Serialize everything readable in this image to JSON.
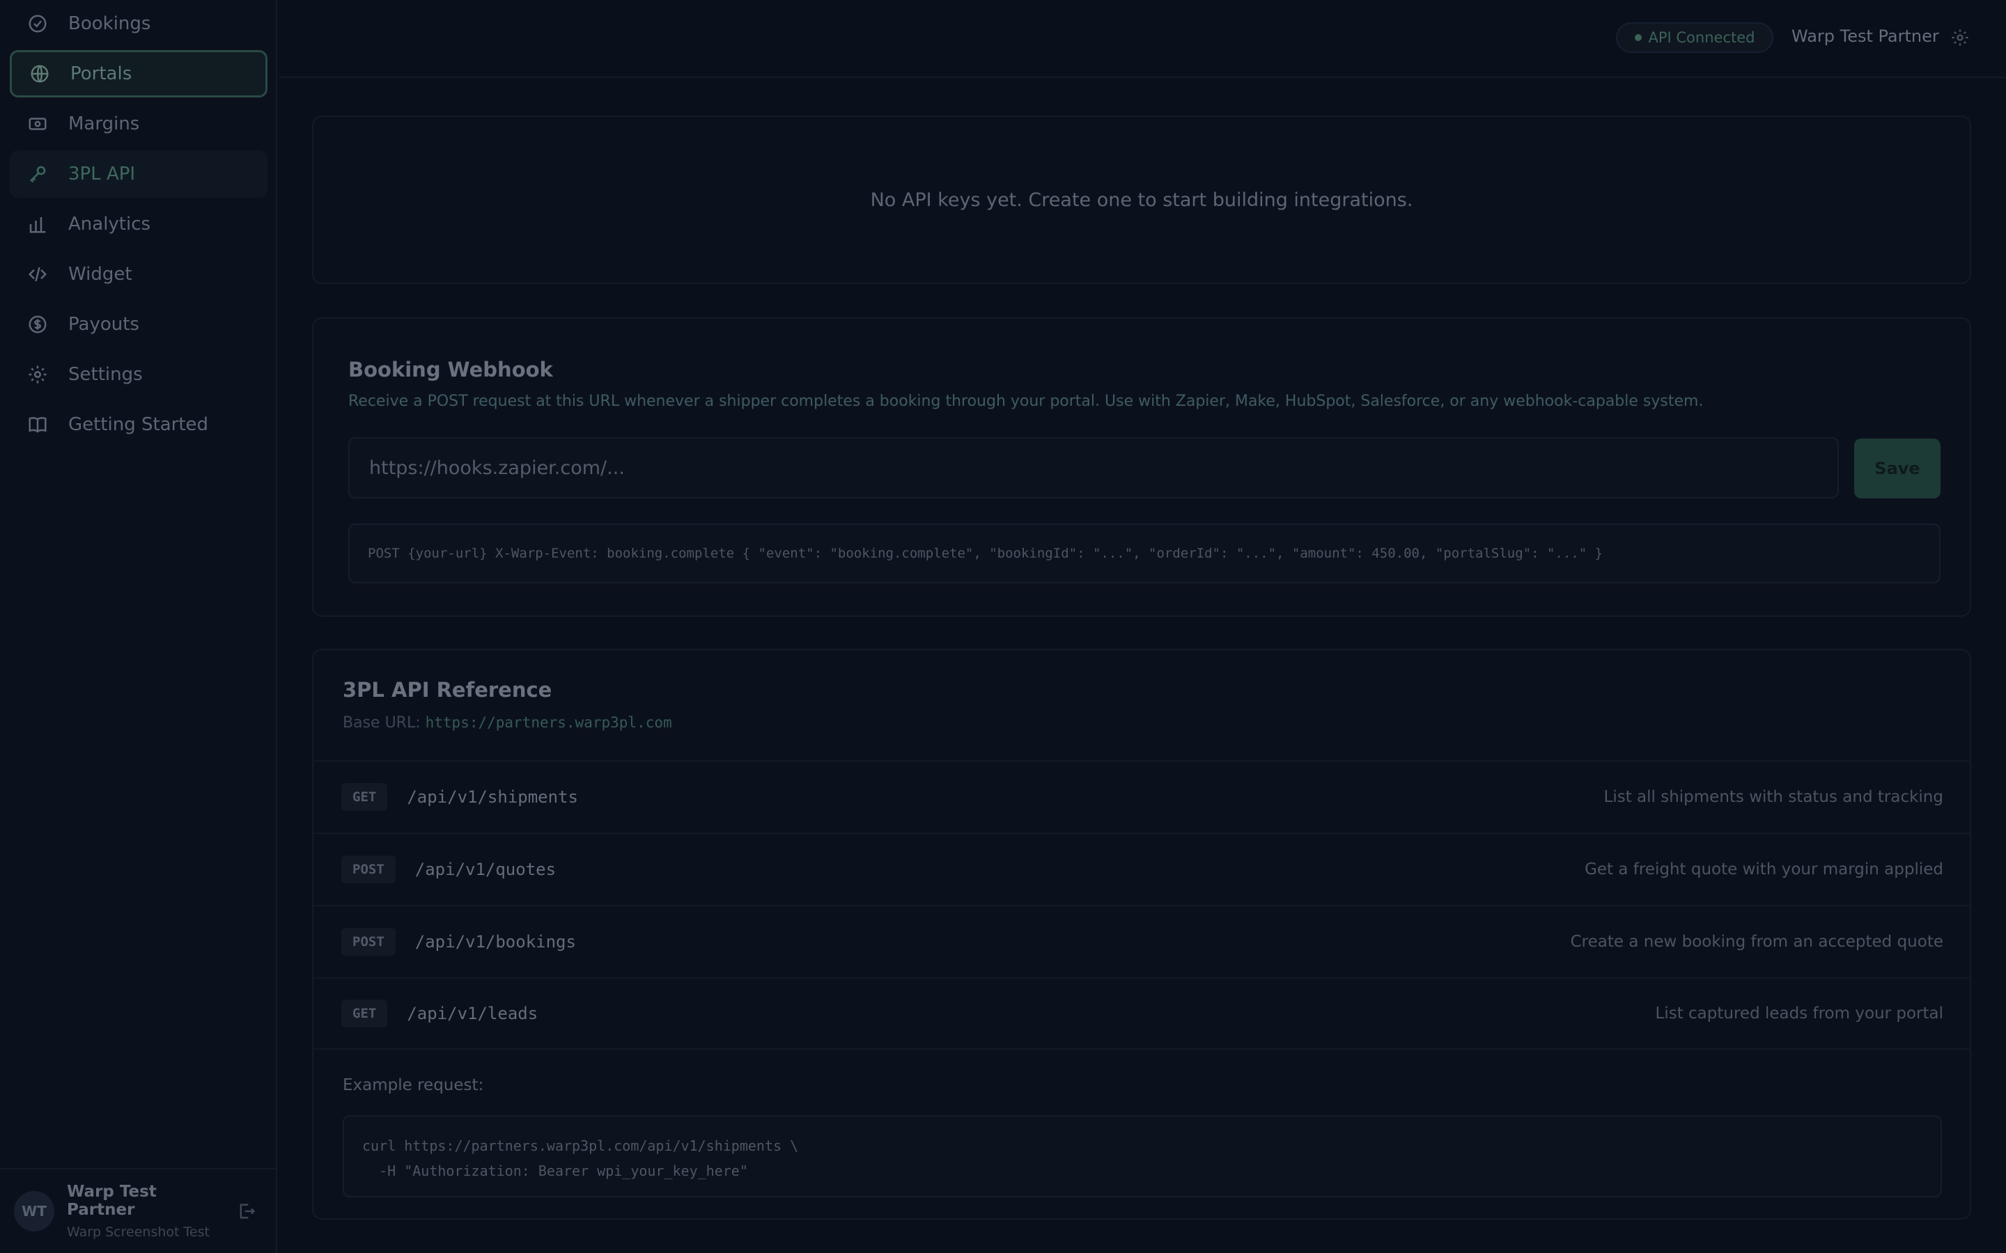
{
  "sidebar": {
    "items": [
      {
        "label": "Bookings",
        "icon": "check-circle-icon"
      },
      {
        "label": "Portals",
        "icon": "globe-icon"
      },
      {
        "label": "Margins",
        "icon": "banknote-icon"
      },
      {
        "label": "3PL API",
        "icon": "key-icon"
      },
      {
        "label": "Analytics",
        "icon": "bar-chart-icon"
      },
      {
        "label": "Widget",
        "icon": "code-icon"
      },
      {
        "label": "Payouts",
        "icon": "dollar-circle-icon"
      },
      {
        "label": "Settings",
        "icon": "gear-icon"
      },
      {
        "label": "Getting Started",
        "icon": "book-icon"
      }
    ],
    "footer": {
      "initials": "WT",
      "name": "Warp Test Partner",
      "org": "Warp Screenshot Test"
    }
  },
  "topbar": {
    "api_status": "API Connected",
    "partner_name": "Warp Test Partner"
  },
  "api_keys": {
    "empty_text": "No API keys yet. Create one to start building integrations."
  },
  "webhook": {
    "title": "Booking Webhook",
    "description": "Receive a POST request at this URL whenever a shipper completes a booking through your portal. Use with Zapier, Make, HubSpot, Salesforce, or any webhook-capable system.",
    "placeholder": "https://hooks.zapier.com/...",
    "save_label": "Save",
    "payload": "POST {your-url} X-Warp-Event: booking.complete { \"event\": \"booking.complete\", \"bookingId\": \"...\", \"orderId\": \"...\", \"amount\": 450.00, \"portalSlug\": \"...\" }"
  },
  "reference": {
    "title": "3PL API Reference",
    "base_label": "Base URL: ",
    "base_url": "https://partners.warp3pl.com",
    "endpoints": [
      {
        "method": "GET",
        "path": "/api/v1/shipments",
        "desc": "List all shipments with status and tracking"
      },
      {
        "method": "POST",
        "path": "/api/v1/quotes",
        "desc": "Get a freight quote with your margin applied"
      },
      {
        "method": "POST",
        "path": "/api/v1/bookings",
        "desc": "Create a new booking from an accepted quote"
      },
      {
        "method": "GET",
        "path": "/api/v1/leads",
        "desc": "List captured leads from your portal"
      }
    ],
    "example_label": "Example request:",
    "example_code": "curl https://partners.warp3pl.com/api/v1/shipments \\\n  -H \"Authorization: Bearer wpi_your_key_here\""
  }
}
